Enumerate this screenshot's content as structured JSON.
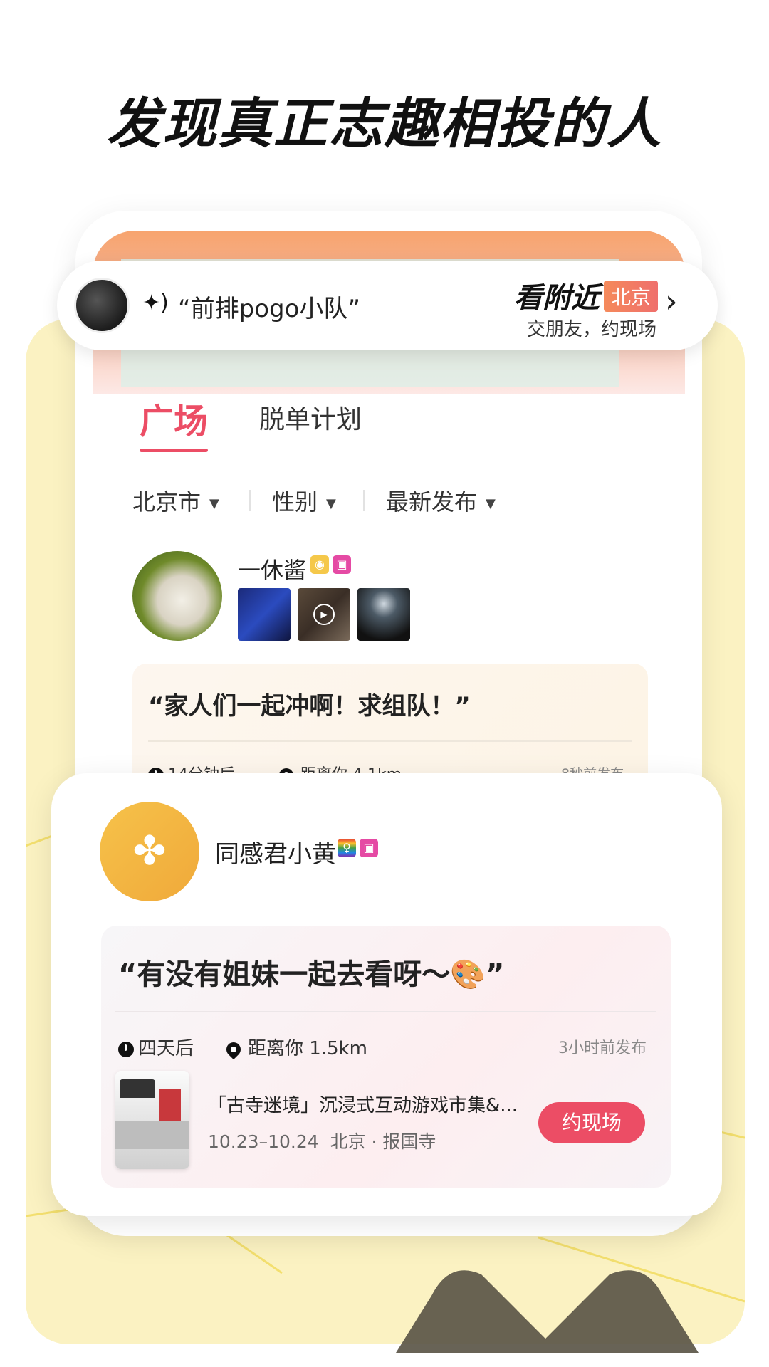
{
  "headline": "发现真正志趣相投的人",
  "nearby": {
    "quote": "“前排pogo小队”",
    "title": "看附近",
    "city": "北京",
    "subtitle": "交朋友，约现场"
  },
  "tabs": [
    {
      "label": "广场",
      "active": true
    },
    {
      "label": "脱单计划",
      "active": false
    }
  ],
  "filters": [
    {
      "label": "北京市"
    },
    {
      "label": "性别"
    },
    {
      "label": "最新发布"
    }
  ],
  "post1": {
    "user": "一休酱",
    "quote": "“家人们一起冲啊！求组队！”",
    "time": "14分钟后",
    "distance": "距离你 4.1km",
    "posted": "8秒前发布"
  },
  "post2": {
    "user": "同感君小黄",
    "quote": "“有没有姐妹一起去看呀～🎨”",
    "time": "四天后",
    "distance": "距离你 1.5km",
    "posted": "3小时前发布",
    "event_title": "「古寺迷境」沉浸式互动游戏市集&...",
    "event_date": "10.23–10.24",
    "event_place": "北京 · 报国寺",
    "cta": "约现场"
  },
  "icons": {
    "wave": "sound-wave-icon",
    "chevron": "chevron-right-icon",
    "caret": "caret-down-icon",
    "clock": "clock-icon",
    "pin": "location-pin-icon",
    "play": "play-icon"
  },
  "colors": {
    "accent": "#ec4d65",
    "badge": "#f58a5b",
    "yellow_bg": "#fbf2c2"
  }
}
